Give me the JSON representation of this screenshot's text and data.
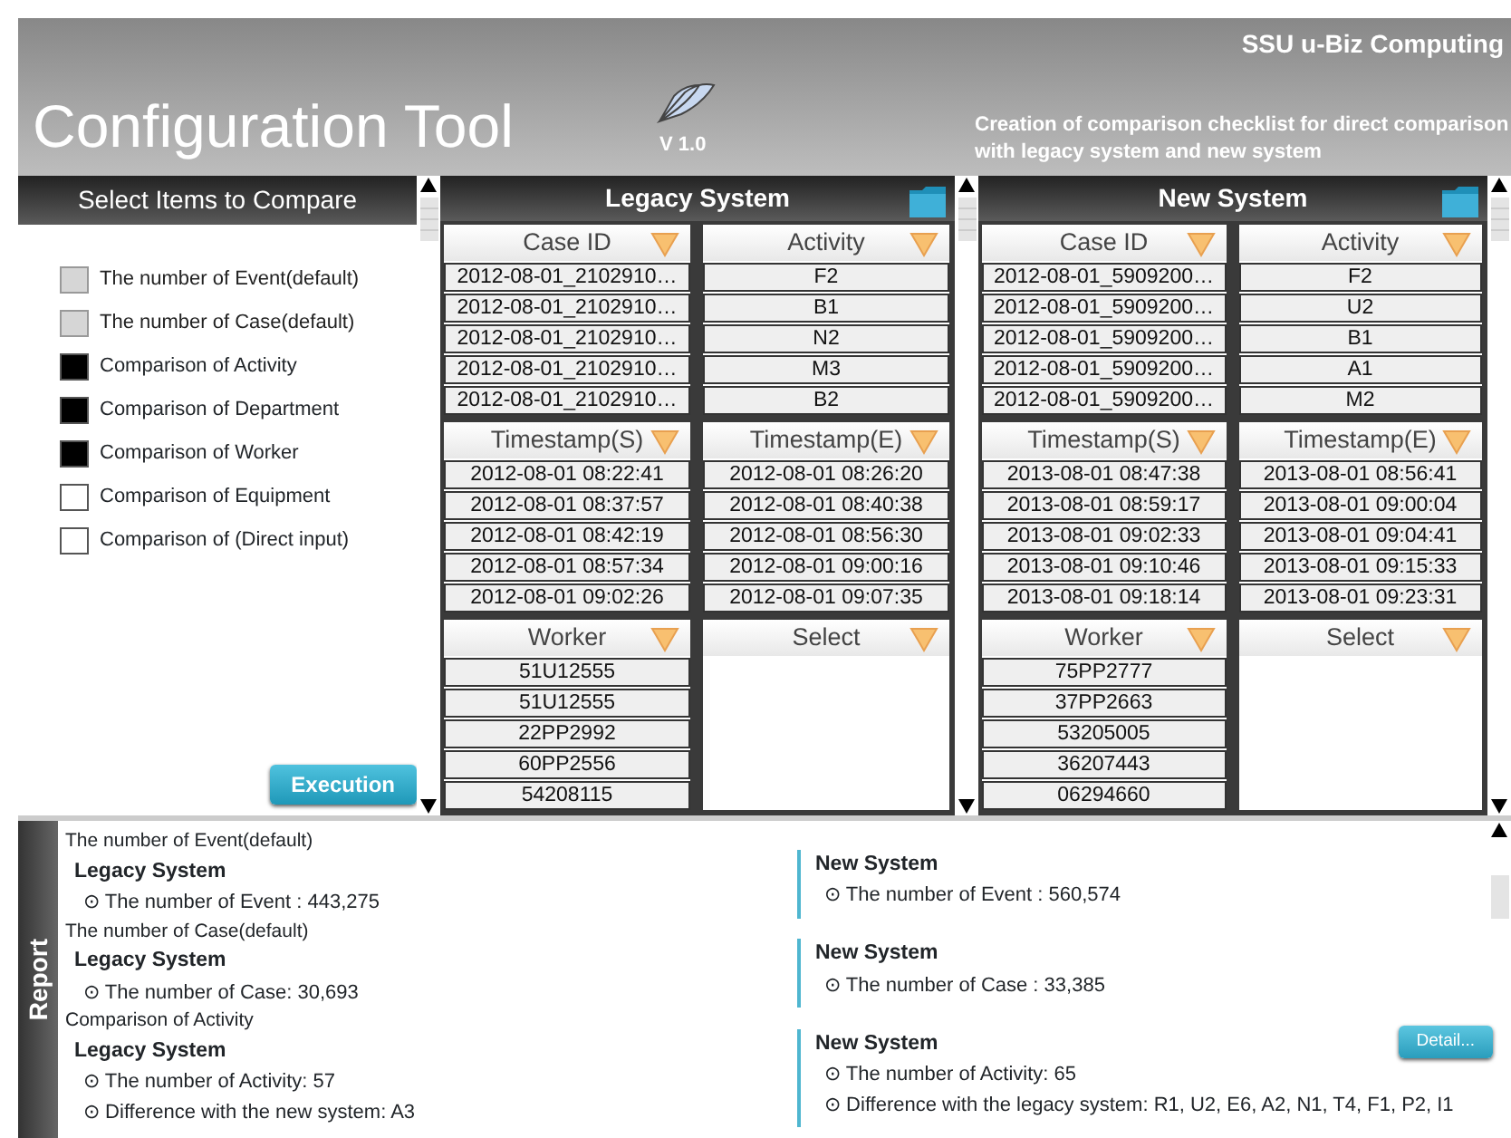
{
  "header": {
    "org": "SSU u-Biz Computing",
    "title": "Configuration Tool",
    "version": "V 1.0",
    "description": [
      "Creation of comparison checklist for direct comparison",
      "with legacy system and new system"
    ]
  },
  "selector": {
    "title": "Select Items to Compare",
    "items": [
      {
        "label": "The number  of Event(default)",
        "disabled": true,
        "checked": false
      },
      {
        "label": "The number  of Case(default)",
        "disabled": true,
        "checked": false
      },
      {
        "label": "Comparison  of Activity",
        "disabled": false,
        "checked": true
      },
      {
        "label": "Comparison  of Department",
        "disabled": false,
        "checked": true
      },
      {
        "label": "Comparison  of Worker",
        "disabled": false,
        "checked": true
      },
      {
        "label": "Comparison  of Equipment",
        "disabled": false,
        "checked": false
      },
      {
        "label": "Comparison  of (Direct input)",
        "disabled": false,
        "checked": false
      }
    ],
    "button": "Execution"
  },
  "systems": [
    {
      "title": "Legacy System",
      "blocks": [
        {
          "label": "Case ID",
          "rows": [
            "2012-08-01_2102910…",
            "2012-08-01_2102910…",
            "2012-08-01_2102910…",
            "2012-08-01_2102910…",
            "2012-08-01_2102910…"
          ]
        },
        {
          "label": "Activity",
          "rows": [
            "F2",
            "B1",
            "N2",
            "M3",
            "B2"
          ]
        },
        {
          "label": "Timestamp(S)",
          "rows": [
            "2012-08-01 08:22:41",
            "2012-08-01 08:37:57",
            "2012-08-01 08:42:19",
            "2012-08-01 08:57:34",
            "2012-08-01 09:02:26"
          ]
        },
        {
          "label": "Timestamp(E)",
          "rows": [
            "2012-08-01 08:26:20",
            "2012-08-01 08:40:38",
            "2012-08-01 08:56:30",
            "2012-08-01 09:00:16",
            "2012-08-01 09:07:35"
          ]
        },
        {
          "label": "Worker",
          "rows": [
            "51U12555",
            "51U12555",
            "22PP2992",
            "60PP2556",
            "54208115"
          ]
        },
        {
          "label": "Select"
        }
      ]
    },
    {
      "title": "New System",
      "blocks": [
        {
          "label": "Case ID",
          "rows": [
            "2012-08-01_5909200…",
            "2012-08-01_5909200…",
            "2012-08-01_5909200…",
            "2012-08-01_5909200…",
            "2012-08-01_5909200…"
          ]
        },
        {
          "label": "Activity",
          "rows": [
            "F2",
            "U2",
            "B1",
            "A1",
            "M2"
          ]
        },
        {
          "label": "Timestamp(S)",
          "rows": [
            "2013-08-01 08:47:38",
            "2013-08-01 08:59:17",
            "2013-08-01 09:02:33",
            "2013-08-01 09:10:46",
            "2013-08-01 09:18:14"
          ]
        },
        {
          "label": "Timestamp(E)",
          "rows": [
            "2013-08-01 08:56:41",
            "2013-08-01 09:00:04",
            "2013-08-01 09:04:41",
            "2013-08-01 09:15:33",
            "2013-08-01 09:23:31"
          ]
        },
        {
          "label": "Worker",
          "rows": [
            "75PP2777",
            "37PP2663",
            "53205005",
            "36207443",
            "06294660"
          ]
        },
        {
          "label": "Select"
        }
      ]
    }
  ],
  "report": {
    "tab": "Report",
    "sections": [
      {
        "heading": "The number  of Event(default)",
        "legacy": {
          "title": "Legacy System",
          "lines": [
            "The number of Event : 443,275"
          ]
        },
        "new": {
          "title": "New System",
          "lines": [
            "The number of Event : 560,574"
          ]
        }
      },
      {
        "heading": "The number  of Case(default)",
        "legacy": {
          "title": "Legacy System",
          "lines": [
            "The number of Case: 30,693"
          ]
        },
        "new": {
          "title": "New System",
          "lines": [
            "The number of Case : 33,385"
          ]
        }
      },
      {
        "heading": "Comparison  of Activity",
        "legacy": {
          "title": "Legacy System",
          "lines": [
            "The number of Activity: 57",
            "Difference with the new system: A3"
          ]
        },
        "new": {
          "title": "New System",
          "lines": [
            "The number of Activity: 65",
            "Difference with the legacy system: R1, U2, E6, A2, N1, T4, F1, P2, I1"
          ]
        }
      }
    ],
    "button": "Detail...",
    "bullet": "⊙"
  }
}
